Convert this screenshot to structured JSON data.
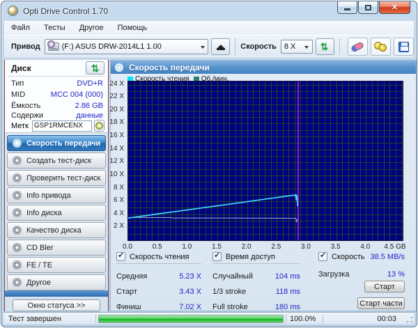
{
  "window": {
    "title": "Opti Drive Control 1.70"
  },
  "icons": {
    "check": "✔",
    "refresh": "⇄",
    "close": "✕",
    "status_arrows": ">>"
  },
  "menu": {
    "items": [
      "Файл",
      "Тесты",
      "Другое",
      "Помощь"
    ]
  },
  "toolbar": {
    "drive_label": "Привод",
    "drive_value": "(F:)   ASUS DRW-2014L1 1.00",
    "speed_label": "Скорость",
    "speed_value": "8 X"
  },
  "disk_panel": {
    "title": "Диск",
    "rows": [
      {
        "label": "Тип",
        "value": "DVD+R"
      },
      {
        "label": "MID",
        "value": "MCC 004 (000)"
      },
      {
        "label": "Ёмкость",
        "value": "2.86 GB"
      },
      {
        "label": "Содержи",
        "value": "данные"
      }
    ],
    "label": {
      "name": "Метк",
      "value": "GSP1RMCENX"
    }
  },
  "sidebar": {
    "items": [
      "Скорость передачи",
      "Создать тест-диск",
      "Проверить тест-диск",
      "Info привода",
      "Info диска",
      "Качество диска",
      "CD Bler",
      "FE / TE",
      "Другое"
    ],
    "active_index": 0,
    "status_button": "Окно статуса >>"
  },
  "main": {
    "header": "Скорость передачи"
  },
  "chart_data": {
    "type": "line",
    "title": "Скорость передачи",
    "x_unit": "GB",
    "xlim": [
      0,
      4.5
    ],
    "ylim": [
      0,
      24.5
    ],
    "bg": "#000082",
    "grid": {
      "x_step": 0.1,
      "y_step": 1,
      "color": "#234428",
      "on": true
    },
    "x_ticks": [
      {
        "v": 0,
        "label": "0.0"
      },
      {
        "v": 0.5,
        "label": "0.5"
      },
      {
        "v": 1.0,
        "label": "1.0"
      },
      {
        "v": 1.5,
        "label": "1.5"
      },
      {
        "v": 2.0,
        "label": "2.0"
      },
      {
        "v": 2.5,
        "label": "2.5"
      },
      {
        "v": 3.0,
        "label": "3.0"
      },
      {
        "v": 3.5,
        "label": "3.5"
      },
      {
        "v": 4.0,
        "label": "4.0"
      },
      {
        "v": 4.5,
        "label": "4.5 GB"
      }
    ],
    "y_ticks": [
      {
        "v": 24,
        "label": "24 X"
      },
      {
        "v": 22,
        "label": "22 X"
      },
      {
        "v": 20,
        "label": "20 X"
      },
      {
        "v": 18,
        "label": "18 X"
      },
      {
        "v": 16,
        "label": "16 X"
      },
      {
        "v": 14,
        "label": "14 X"
      },
      {
        "v": 12,
        "label": "12 X"
      },
      {
        "v": 10,
        "label": "10 X"
      },
      {
        "v": 8,
        "label": "8 X"
      },
      {
        "v": 6,
        "label": "6 X"
      },
      {
        "v": 4,
        "label": "4 X"
      },
      {
        "v": 2,
        "label": "2 X"
      }
    ],
    "marker": {
      "x": 2.86,
      "color": "#c02cc8"
    },
    "legend": [
      {
        "label": "Скорость чтения",
        "color": "#00e4f4"
      },
      {
        "label": "Об./мин.",
        "color": "#2e7d76"
      }
    ],
    "legend_position": "top-left",
    "series": [
      {
        "name": "Скорость чтения",
        "color": "#3ed2ee",
        "points": [
          [
            0,
            3.43
          ],
          [
            0.5,
            4.06
          ],
          [
            1.0,
            4.69
          ],
          [
            1.5,
            5.32
          ],
          [
            2.0,
            5.95
          ],
          [
            2.5,
            6.6
          ],
          [
            2.78,
            6.95
          ],
          [
            2.8,
            6.88
          ],
          [
            2.82,
            7.02
          ],
          [
            2.83,
            6.15
          ],
          [
            2.84,
            6.95
          ],
          [
            2.85,
            5.25
          ]
        ]
      },
      {
        "name": "Об./мин.",
        "color": "#8fa6b8",
        "points": [
          [
            0,
            3.5
          ],
          [
            0.72,
            3.5
          ],
          [
            0.76,
            3.43
          ],
          [
            2.0,
            3.42
          ],
          [
            2.82,
            3.4
          ],
          [
            2.83,
            2.85
          ],
          [
            2.85,
            3.3
          ]
        ]
      }
    ]
  },
  "stats": {
    "groups": [
      {
        "title": "Скорость чтения",
        "checked": true,
        "rows": [
          {
            "label": "Средняя",
            "value": "5.23 X"
          },
          {
            "label": "Старт",
            "value": "3.43 X"
          },
          {
            "label": "Финиш",
            "value": "7.02 X"
          }
        ]
      },
      {
        "title": "Время доступ",
        "checked": true,
        "rows": [
          {
            "label": "Случайный",
            "value": "104 ms"
          },
          {
            "label": "1/3 stroke",
            "value": "118 ms"
          },
          {
            "label": "Full stroke",
            "value": "180 ms"
          }
        ]
      },
      {
        "title": "Скорость",
        "checked": true,
        "value": "38.5 MB/s",
        "rows": [
          {
            "label": "Загрузка",
            "value": "13 %"
          }
        ],
        "buttons": [
          "Старт",
          "Старт части"
        ]
      }
    ]
  },
  "statusbar": {
    "status": "Тест завершен",
    "percent": "100.0%",
    "progress_value": 100,
    "time": "00:03"
  }
}
